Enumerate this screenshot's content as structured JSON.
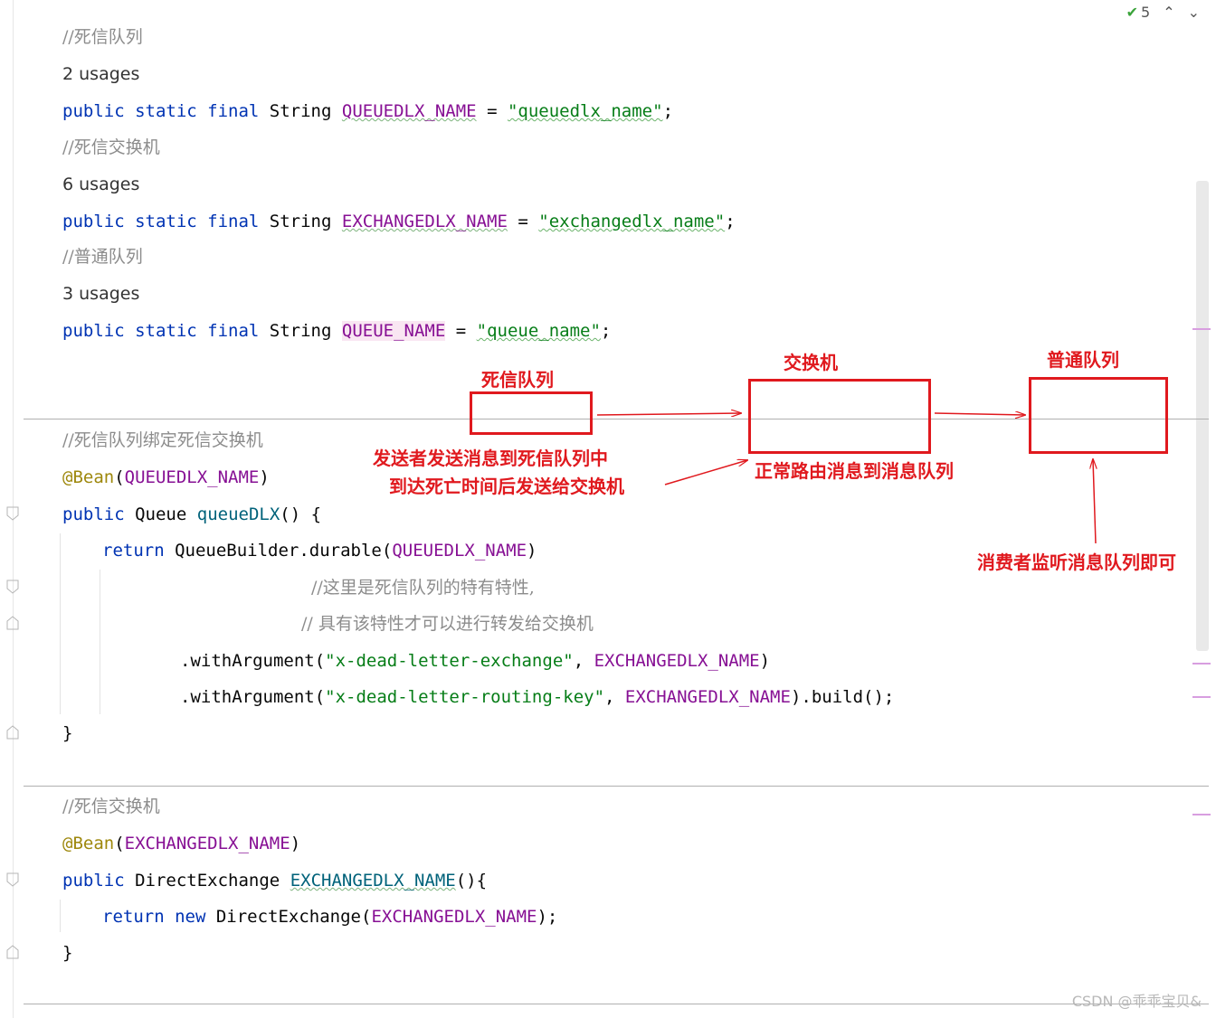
{
  "topbar": {
    "check_count": "5"
  },
  "code": {
    "c1": "//死信队列",
    "u1": "2 usages",
    "l1": {
      "kw": "public static final",
      "type": "String",
      "name": "QUEUEDLX_NAME",
      "eq": "=",
      "str": "\"queuedlx_name\"",
      "end": ";"
    },
    "c2": "//死信交换机",
    "u2": "6 usages",
    "l2": {
      "kw": "public static final",
      "type": "String",
      "name": "EXCHANGEDLX_NAME",
      "eq": "=",
      "str": "\"exchangedlx_name\"",
      "end": ";"
    },
    "c3": "//普通队列",
    "u3": "3 usages",
    "l3": {
      "kw": "public static final",
      "type": "String",
      "name": "QUEUE_NAME",
      "eq": "=",
      "str": "\"queue_name\"",
      "end": ";"
    },
    "c4": "//死信队列绑定死信交换机",
    "bean1": {
      "ann": "@Bean",
      "open": "(",
      "arg": "QUEUEDLX_NAME",
      "close": ")"
    },
    "m1": {
      "kw": "public",
      "type": "Queue",
      "name": "queueDLX",
      "rest": "() {"
    },
    "ret1": {
      "kw": "return",
      "call": "QueueBuilder.durable(",
      "arg": "QUEUEDLX_NAME",
      "close": ")"
    },
    "c5": "//这里是死信队列的特有特性,",
    "c6": "// 具有该特性才可以进行转发给交换机",
    "wa1": {
      "call": ".withArgument(",
      "str": "\"x-dead-letter-exchange\"",
      "sep": ", ",
      "arg": "EXCHANGEDLX_NAME",
      "close": ")"
    },
    "wa2": {
      "call": ".withArgument(",
      "str": "\"x-dead-letter-routing-key\"",
      "sep": ", ",
      "arg": "EXCHANGEDLX_NAME",
      "close": ").build();"
    },
    "brace1": "}",
    "c7": "//死信交换机",
    "bean2": {
      "ann": "@Bean",
      "open": "(",
      "arg": "EXCHANGEDLX_NAME",
      "close": ")"
    },
    "m2": {
      "kw": "public",
      "type": "DirectExchange",
      "name": "EXCHANGEDLX_NAME",
      "rest": "(){"
    },
    "ret2": {
      "kw": "return new",
      "call": "DirectExchange(",
      "arg": "EXCHANGEDLX_NAME",
      "close": ");"
    },
    "brace2": "}"
  },
  "annotations": {
    "box1_label": "死信队列",
    "box2_label": "交换机",
    "box3_label": "普通队列",
    "note1_line1": "发送者发送消息到死信队列中",
    "note1_line2": "到达死亡时间后发送给交换机",
    "note2": "正常路由消息到消息队列",
    "note3": "消费者监听消息队列即可"
  },
  "watermark": "CSDN @乖乖宝贝&"
}
